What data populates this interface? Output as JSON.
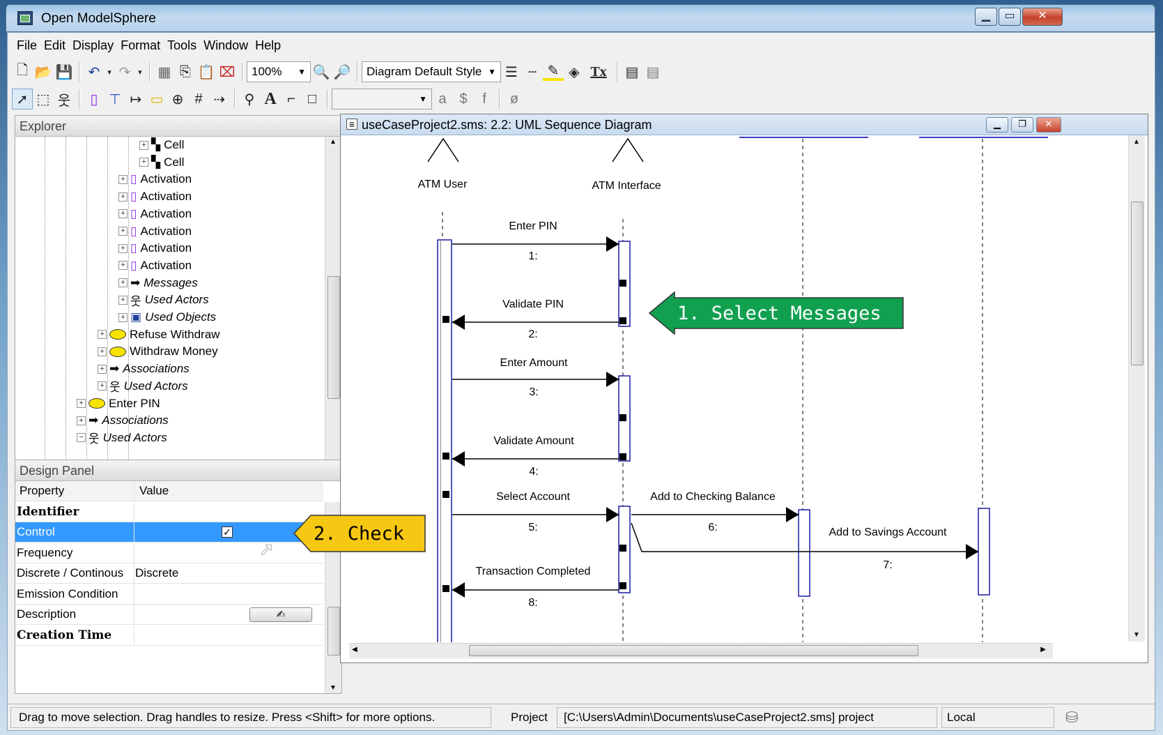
{
  "window": {
    "title": "Open ModelSphere"
  },
  "menu": [
    "File",
    "Edit",
    "Display",
    "Format",
    "Tools",
    "Window",
    "Help"
  ],
  "toolbar": {
    "zoom": "100%",
    "style": "Diagram Default Style",
    "text_a": "A",
    "tx": "Tx",
    "char_a": "a",
    "char_dollar": "$",
    "char_f": "f",
    "char_null": "ø"
  },
  "explorer": {
    "title": "Explorer",
    "items": [
      {
        "label": "Cell",
        "icon": "cell-icon",
        "level": 8
      },
      {
        "label": "Cell",
        "icon": "cell-icon",
        "level": 8
      },
      {
        "label": "Activation",
        "icon": "activation-icon",
        "level": 7
      },
      {
        "label": "Activation",
        "icon": "activation-icon",
        "level": 7
      },
      {
        "label": "Activation",
        "icon": "activation-icon",
        "level": 7
      },
      {
        "label": "Activation",
        "icon": "activation-icon",
        "level": 7
      },
      {
        "label": "Activation",
        "icon": "activation-icon",
        "level": 7
      },
      {
        "label": "Activation",
        "icon": "activation-icon",
        "level": 7
      },
      {
        "label": "Messages",
        "icon": "messages-icon",
        "level": 7,
        "italic": true
      },
      {
        "label": "Used Actors",
        "icon": "actors-icon",
        "level": 7,
        "italic": true
      },
      {
        "label": "Used Objects",
        "icon": "objects-icon",
        "level": 7,
        "italic": true
      },
      {
        "label": "Refuse Withdraw",
        "icon": "usecase-icon",
        "level": 6
      },
      {
        "label": "Withdraw Money",
        "icon": "usecase-icon",
        "level": 6
      },
      {
        "label": "Associations",
        "icon": "associations-icon",
        "level": 6,
        "italic": true
      },
      {
        "label": "Used Actors",
        "icon": "actors-icon",
        "level": 6,
        "italic": true
      },
      {
        "label": "Enter PIN",
        "icon": "usecase-icon",
        "level": 5
      },
      {
        "label": "Associations",
        "icon": "associations-icon",
        "level": 5,
        "italic": true
      },
      {
        "label": "Used Actors",
        "icon": "actors-icon",
        "level": 5,
        "italic": true,
        "expanded": true
      }
    ]
  },
  "design_panel": {
    "title": "Design Panel",
    "col_property": "Property",
    "col_value": "Value",
    "rows": [
      {
        "property": "Identifier",
        "value": "",
        "bold": true
      },
      {
        "property": "Control",
        "value": "",
        "checked": true,
        "selected": true
      },
      {
        "property": "Frequency",
        "value": ""
      },
      {
        "property": "Discrete / Continous",
        "value": "Discrete"
      },
      {
        "property": "Emission Condition",
        "value": ""
      },
      {
        "property": "Description",
        "value": "",
        "has_button": true
      },
      {
        "property": "Creation Time",
        "value": "",
        "bold": true
      }
    ]
  },
  "diagram": {
    "title": "useCaseProject2.sms: 2.2: UML Sequence Diagram",
    "actors": [
      "ATM User",
      "ATM Interface"
    ],
    "messages": [
      {
        "label": "Enter PIN",
        "seq": "1:"
      },
      {
        "label": "Validate PIN",
        "seq": "2:"
      },
      {
        "label": "Enter Amount",
        "seq": "3:"
      },
      {
        "label": "Validate Amount",
        "seq": "4:"
      },
      {
        "label": "Select Account",
        "seq": "5:"
      },
      {
        "label": "Add to Checking Balance",
        "seq": "6:"
      },
      {
        "label": "Add to Savings Account",
        "seq": "7:"
      },
      {
        "label": "Transaction Completed",
        "seq": "8:"
      }
    ]
  },
  "callouts": {
    "select_messages": "1. Select Messages",
    "check": "2. Check",
    "select_color": "#10a050",
    "check_color": "#f6c814"
  },
  "status": {
    "hint": "Drag to move selection.  Drag handles to resize.  Press <Shift> for more options.",
    "project_label": "Project",
    "project_path": "[C:\\Users\\Admin\\Documents\\useCaseProject2.sms]  project",
    "scope": "Local"
  }
}
